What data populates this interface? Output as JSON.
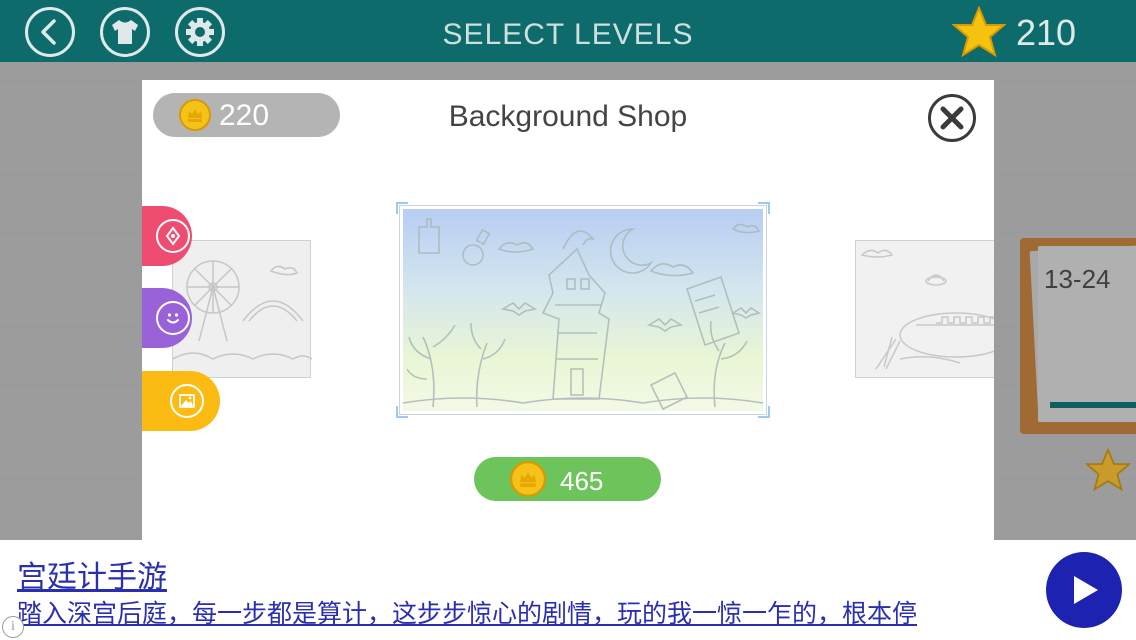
{
  "header": {
    "title": "SELECT LEVELS",
    "star_total": "210",
    "icons": [
      "back-arrow-icon",
      "shirt-icon",
      "gear-icon",
      "star-icon"
    ]
  },
  "background": {
    "level_range": "13-24"
  },
  "shop": {
    "title": "Background Shop",
    "coin_balance": "220",
    "price": "465",
    "categories": [
      {
        "icon": "pen-nib-icon",
        "color": "#ee4d71"
      },
      {
        "icon": "smiley-icon",
        "color": "#9a62d8"
      },
      {
        "icon": "picture-icon",
        "color": "#fbbb13"
      }
    ],
    "selected_category": "picture-icon"
  },
  "ad": {
    "title": "宫廷计手游",
    "description": "踏入深宫后庭，每一步都是算计，这步步惊心的剧情，玩的我一惊一乍的，根本停",
    "info_glyph": "i"
  },
  "colors": {
    "topbar": "#0e6b6b",
    "price_green": "#6cc45a",
    "coin_gold": "#f5c21a",
    "ad_link": "#2a2fb0"
  }
}
